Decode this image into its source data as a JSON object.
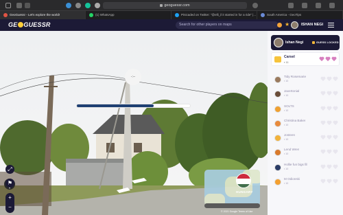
{
  "browser": {
    "address": "geoguessr.com",
    "tabs": [
      {
        "label": "GeoGuessr - Let's explore the world!",
        "fav": "#e05444",
        "active": true
      },
      {
        "label": "(1) WhatsApp",
        "fav": "#25d366",
        "active": false
      },
      {
        "label": "Pinicaded on Twitter: \"@elli_il it started in for a ride\" |...",
        "fav": "#1da1f2",
        "active": false
      },
      {
        "label": "South America - GeoTips",
        "fav": "#6b8bd6",
        "active": false
      }
    ]
  },
  "header": {
    "logo_left": "GE",
    "logo_right": "GUESSR",
    "search_placeholder": "Search for other players on maps",
    "username": "ISHAN NEGI"
  },
  "streetview": {
    "timer_label": "-:--",
    "progress": 0.68,
    "country": "HUNGARY",
    "google_footer": "© 2021 Google   Terms of Use",
    "flag_colors": [
      "#cd2a3e",
      "#ffffff",
      "#436f4d"
    ]
  },
  "sidebar": {
    "me": {
      "name": "Ishan Negi",
      "status": "GUESS LOCKED"
    },
    "team": {
      "name": "Carsel",
      "sub": "▪ 11",
      "hearts": 3
    },
    "players": [
      {
        "name": "Tidy Rosemarie",
        "sub": "▪ 10",
        "color": "#9a7a5e"
      },
      {
        "name": "Javertonial",
        "sub": "▪ 10",
        "color": "#6a4d3a"
      },
      {
        "name": "SOLTS",
        "sub": "▪ 10",
        "color": "#f0a030"
      },
      {
        "name": "Christina Baker",
        "sub": "▪ 10",
        "color": "#e88a3c"
      },
      {
        "name": "Josteen",
        "sub": "▪ 10",
        "color": "#f2b23a"
      },
      {
        "name": "Lend Wren",
        "sub": "▪ 10",
        "color": "#d97a2c"
      },
      {
        "name": "Hollie fun bigs fill",
        "sub": "▪ 10",
        "color": "#2a3c66"
      },
      {
        "name": "M Odionski",
        "sub": "▪ 10",
        "color": "#f4a030"
      }
    ],
    "heart_on": "#d77fbf",
    "heart_off": "#e8e6ee"
  }
}
